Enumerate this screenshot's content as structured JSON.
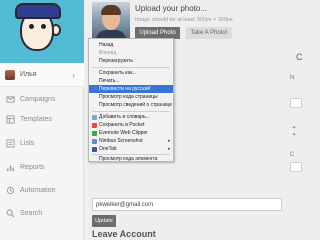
{
  "sidebar": {
    "user_label": "Илья",
    "items": [
      {
        "label": "Campaigns"
      },
      {
        "label": "Templates"
      },
      {
        "label": "Lists"
      },
      {
        "label": "Reports"
      },
      {
        "label": "Automation"
      },
      {
        "label": "Search"
      }
    ]
  },
  "photo_section": {
    "title": "Upload your photo...",
    "hint": "Image should be at least 300px × 300px",
    "upload_button": "Upload Photo",
    "take_photo_button": "Take A Photo!"
  },
  "form": {
    "email_value": "pkweiker@gmail.com",
    "update_button": "Update"
  },
  "leave_account": "Leave Account",
  "right_column": {
    "heading_fragment": "C",
    "field_labels": [
      "N",
      "C"
    ]
  },
  "context_menu": {
    "items": [
      {
        "label": "Назад",
        "state": "enabled"
      },
      {
        "label": "Вперёд",
        "state": "disabled"
      },
      {
        "label": "Перезагрузить",
        "state": "enabled"
      },
      {
        "label": "Сохранить как...",
        "state": "enabled"
      },
      {
        "label": "Печать...",
        "state": "enabled"
      },
      {
        "label": "Перевести на русский",
        "state": "highlighted"
      },
      {
        "label": "Просмотр кода страницы",
        "state": "enabled"
      },
      {
        "label": "Просмотр сведений о странице",
        "state": "enabled"
      },
      {
        "label": "Добавить в словарь...",
        "state": "enabled"
      },
      {
        "label": "Сохранить в Pocket",
        "state": "enabled"
      },
      {
        "label": "Evernote Web Clipper",
        "state": "enabled"
      },
      {
        "label": "Nimbus Screenshot",
        "state": "enabled"
      },
      {
        "label": "OneTab",
        "state": "enabled"
      },
      {
        "label": "Просмотр кода элемента",
        "state": "enabled"
      }
    ],
    "submenu_arrow": "▸"
  },
  "colors": {
    "brand_blue": "#52bad5",
    "menu_highlight": "#3875d7",
    "button_dark": "#6d6d6d"
  }
}
